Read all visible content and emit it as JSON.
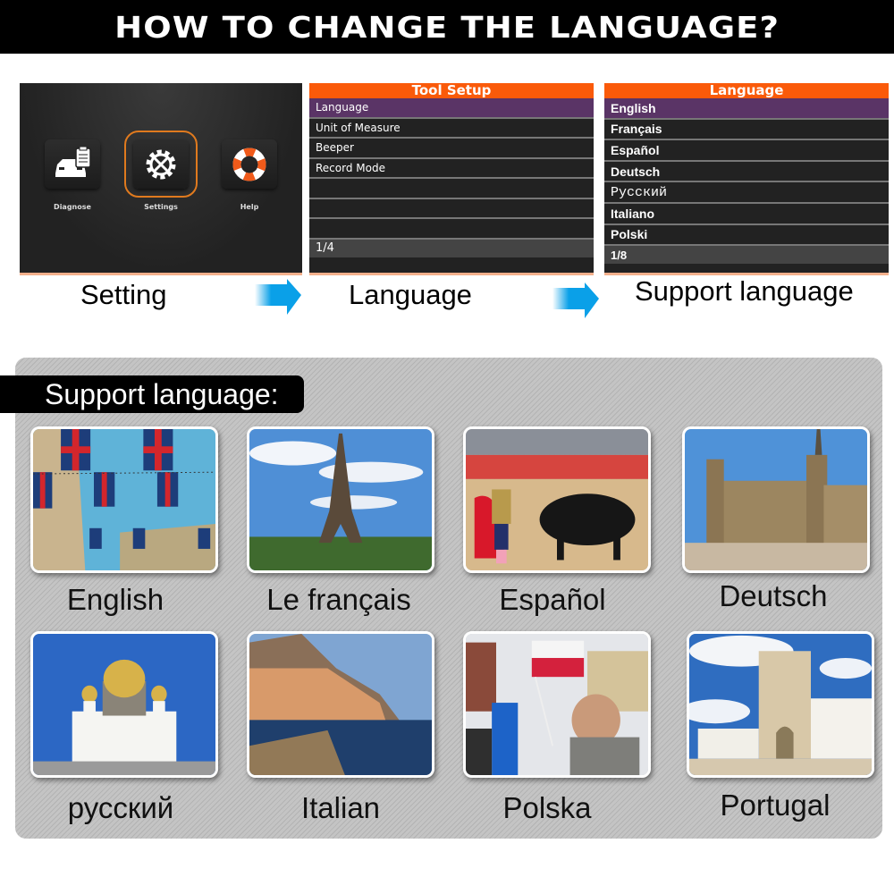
{
  "banner": {
    "title": "HOW TO CHANGE THE LANGUAGE?"
  },
  "home_screen": {
    "tiles": [
      {
        "label": "Diagnose",
        "icon": "car-clipboard-icon"
      },
      {
        "label": "Settings",
        "icon": "gear-wrench-icon",
        "selected": true
      },
      {
        "label": "Help",
        "icon": "lifebuoy-icon"
      }
    ]
  },
  "tool_setup": {
    "title": "Tool Setup",
    "items": [
      "Language",
      "Unit of Measure",
      "Beeper",
      "Record Mode",
      "",
      "",
      ""
    ],
    "selected_index": 0,
    "page": "1/4"
  },
  "language_menu": {
    "title": "Language",
    "items": [
      "English",
      "Français",
      "Español",
      "Deutsch",
      "Русский",
      "Italiano",
      "Polski"
    ],
    "selected_index": 0,
    "page": "1/8"
  },
  "steps": [
    "Setting",
    "Language",
    "Support language"
  ],
  "colors": {
    "accent": "#fa5a0a",
    "selected_row": "#5a3466",
    "arrow": "#0aa0e8"
  },
  "gallery": {
    "heading": "Support language:",
    "cards": [
      {
        "caption": "English",
        "scene": "uk-flags-street"
      },
      {
        "caption": "Le français",
        "scene": "eiffel-tower"
      },
      {
        "caption": "Español",
        "scene": "bullfight"
      },
      {
        "caption": "Deutsch",
        "scene": "dresden-square"
      },
      {
        "caption": "русский",
        "scene": "moscow-cathedral"
      },
      {
        "caption": "Italian",
        "scene": "manarola-coast"
      },
      {
        "caption": "Polska",
        "scene": "polish-flag-crowd"
      },
      {
        "caption": "Portugal",
        "scene": "alcobaca-monastery"
      }
    ]
  }
}
